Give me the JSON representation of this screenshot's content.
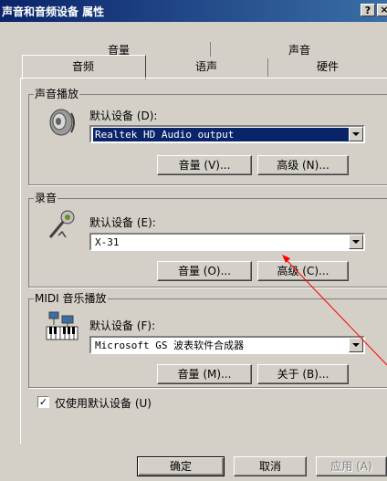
{
  "window": {
    "title": "声音和音频设备 属性",
    "help_label": "?",
    "close_label": "×"
  },
  "tabs": {
    "back_row": [
      "音量",
      "声音"
    ],
    "front_row": [
      "音频",
      "语声",
      "硬件"
    ],
    "active": "音频"
  },
  "playback": {
    "group_title": "声音播放",
    "default_device_label": "默认设备 (D):",
    "device_value": "Realtek HD Audio output",
    "volume_button": "音量 (V)...",
    "advanced_button": "高级 (N)..."
  },
  "recording": {
    "group_title": "录音",
    "default_device_label": "默认设备 (E):",
    "device_value": "X-31",
    "volume_button": "音量 (O)...",
    "advanced_button": "高级 (C)..."
  },
  "midi": {
    "group_title": "MIDI 音乐播放",
    "default_device_label": "默认设备 (F):",
    "device_value": "Microsoft GS 波表软件合成器",
    "volume_button": "音量 (M)...",
    "about_button": "关于 (B)..."
  },
  "options": {
    "use_default_only_label": "仅使用默认设备 (U)",
    "use_default_only_checked": true,
    "check_glyph": "✓"
  },
  "footer": {
    "ok_button": "确定",
    "cancel_button": "取消",
    "apply_button": "应用 (A)"
  },
  "annotation": {
    "arrow_color": "#ff0000"
  }
}
